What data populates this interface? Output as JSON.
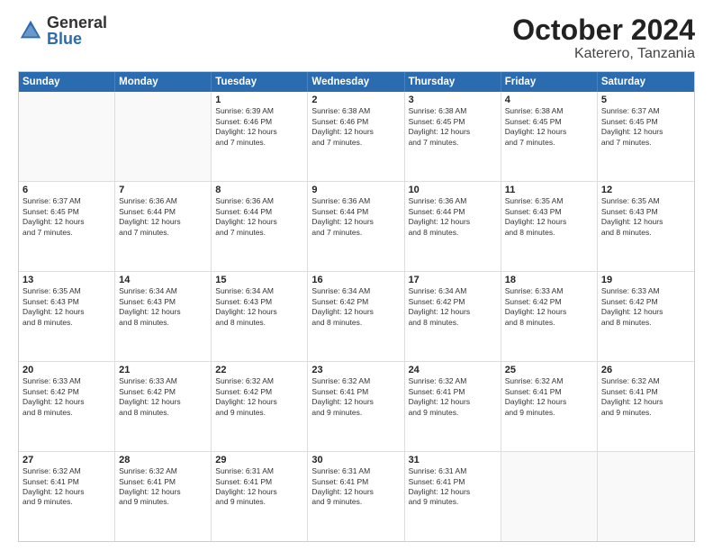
{
  "logo": {
    "general": "General",
    "blue": "Blue"
  },
  "title": "October 2024",
  "location": "Katerero, Tanzania",
  "days_of_week": [
    "Sunday",
    "Monday",
    "Tuesday",
    "Wednesday",
    "Thursday",
    "Friday",
    "Saturday"
  ],
  "weeks": [
    [
      {
        "day": "",
        "info": ""
      },
      {
        "day": "",
        "info": ""
      },
      {
        "day": "1",
        "info": "Sunrise: 6:39 AM\nSunset: 6:46 PM\nDaylight: 12 hours\nand 7 minutes."
      },
      {
        "day": "2",
        "info": "Sunrise: 6:38 AM\nSunset: 6:46 PM\nDaylight: 12 hours\nand 7 minutes."
      },
      {
        "day": "3",
        "info": "Sunrise: 6:38 AM\nSunset: 6:45 PM\nDaylight: 12 hours\nand 7 minutes."
      },
      {
        "day": "4",
        "info": "Sunrise: 6:38 AM\nSunset: 6:45 PM\nDaylight: 12 hours\nand 7 minutes."
      },
      {
        "day": "5",
        "info": "Sunrise: 6:37 AM\nSunset: 6:45 PM\nDaylight: 12 hours\nand 7 minutes."
      }
    ],
    [
      {
        "day": "6",
        "info": "Sunrise: 6:37 AM\nSunset: 6:45 PM\nDaylight: 12 hours\nand 7 minutes."
      },
      {
        "day": "7",
        "info": "Sunrise: 6:36 AM\nSunset: 6:44 PM\nDaylight: 12 hours\nand 7 minutes."
      },
      {
        "day": "8",
        "info": "Sunrise: 6:36 AM\nSunset: 6:44 PM\nDaylight: 12 hours\nand 7 minutes."
      },
      {
        "day": "9",
        "info": "Sunrise: 6:36 AM\nSunset: 6:44 PM\nDaylight: 12 hours\nand 7 minutes."
      },
      {
        "day": "10",
        "info": "Sunrise: 6:36 AM\nSunset: 6:44 PM\nDaylight: 12 hours\nand 8 minutes."
      },
      {
        "day": "11",
        "info": "Sunrise: 6:35 AM\nSunset: 6:43 PM\nDaylight: 12 hours\nand 8 minutes."
      },
      {
        "day": "12",
        "info": "Sunrise: 6:35 AM\nSunset: 6:43 PM\nDaylight: 12 hours\nand 8 minutes."
      }
    ],
    [
      {
        "day": "13",
        "info": "Sunrise: 6:35 AM\nSunset: 6:43 PM\nDaylight: 12 hours\nand 8 minutes."
      },
      {
        "day": "14",
        "info": "Sunrise: 6:34 AM\nSunset: 6:43 PM\nDaylight: 12 hours\nand 8 minutes."
      },
      {
        "day": "15",
        "info": "Sunrise: 6:34 AM\nSunset: 6:43 PM\nDaylight: 12 hours\nand 8 minutes."
      },
      {
        "day": "16",
        "info": "Sunrise: 6:34 AM\nSunset: 6:42 PM\nDaylight: 12 hours\nand 8 minutes."
      },
      {
        "day": "17",
        "info": "Sunrise: 6:34 AM\nSunset: 6:42 PM\nDaylight: 12 hours\nand 8 minutes."
      },
      {
        "day": "18",
        "info": "Sunrise: 6:33 AM\nSunset: 6:42 PM\nDaylight: 12 hours\nand 8 minutes."
      },
      {
        "day": "19",
        "info": "Sunrise: 6:33 AM\nSunset: 6:42 PM\nDaylight: 12 hours\nand 8 minutes."
      }
    ],
    [
      {
        "day": "20",
        "info": "Sunrise: 6:33 AM\nSunset: 6:42 PM\nDaylight: 12 hours\nand 8 minutes."
      },
      {
        "day": "21",
        "info": "Sunrise: 6:33 AM\nSunset: 6:42 PM\nDaylight: 12 hours\nand 8 minutes."
      },
      {
        "day": "22",
        "info": "Sunrise: 6:32 AM\nSunset: 6:42 PM\nDaylight: 12 hours\nand 9 minutes."
      },
      {
        "day": "23",
        "info": "Sunrise: 6:32 AM\nSunset: 6:41 PM\nDaylight: 12 hours\nand 9 minutes."
      },
      {
        "day": "24",
        "info": "Sunrise: 6:32 AM\nSunset: 6:41 PM\nDaylight: 12 hours\nand 9 minutes."
      },
      {
        "day": "25",
        "info": "Sunrise: 6:32 AM\nSunset: 6:41 PM\nDaylight: 12 hours\nand 9 minutes."
      },
      {
        "day": "26",
        "info": "Sunrise: 6:32 AM\nSunset: 6:41 PM\nDaylight: 12 hours\nand 9 minutes."
      }
    ],
    [
      {
        "day": "27",
        "info": "Sunrise: 6:32 AM\nSunset: 6:41 PM\nDaylight: 12 hours\nand 9 minutes."
      },
      {
        "day": "28",
        "info": "Sunrise: 6:32 AM\nSunset: 6:41 PM\nDaylight: 12 hours\nand 9 minutes."
      },
      {
        "day": "29",
        "info": "Sunrise: 6:31 AM\nSunset: 6:41 PM\nDaylight: 12 hours\nand 9 minutes."
      },
      {
        "day": "30",
        "info": "Sunrise: 6:31 AM\nSunset: 6:41 PM\nDaylight: 12 hours\nand 9 minutes."
      },
      {
        "day": "31",
        "info": "Sunrise: 6:31 AM\nSunset: 6:41 PM\nDaylight: 12 hours\nand 9 minutes."
      },
      {
        "day": "",
        "info": ""
      },
      {
        "day": "",
        "info": ""
      }
    ]
  ]
}
